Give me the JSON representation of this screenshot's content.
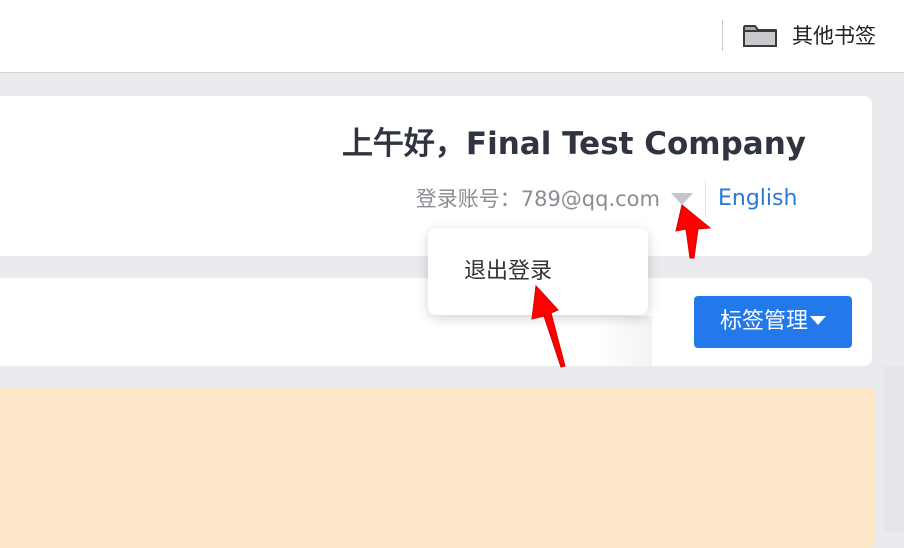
{
  "bookmark_bar": {
    "folder_label": "其他书签",
    "folder_icon": "folder-icon"
  },
  "header": {
    "greeting": "上午好，Final Test Company",
    "account_label": "登录账号：",
    "account_value": "789@qq.com",
    "language_link": "English"
  },
  "dropdown": {
    "items": [
      {
        "label": "退出登录"
      }
    ]
  },
  "toolbar": {
    "tag_button_label": "标签管理"
  },
  "colors": {
    "accent": "#2379ea",
    "link": "#2b78d8",
    "notice_panel": "#fde9c9",
    "annotation_arrow": "#ff0000"
  }
}
